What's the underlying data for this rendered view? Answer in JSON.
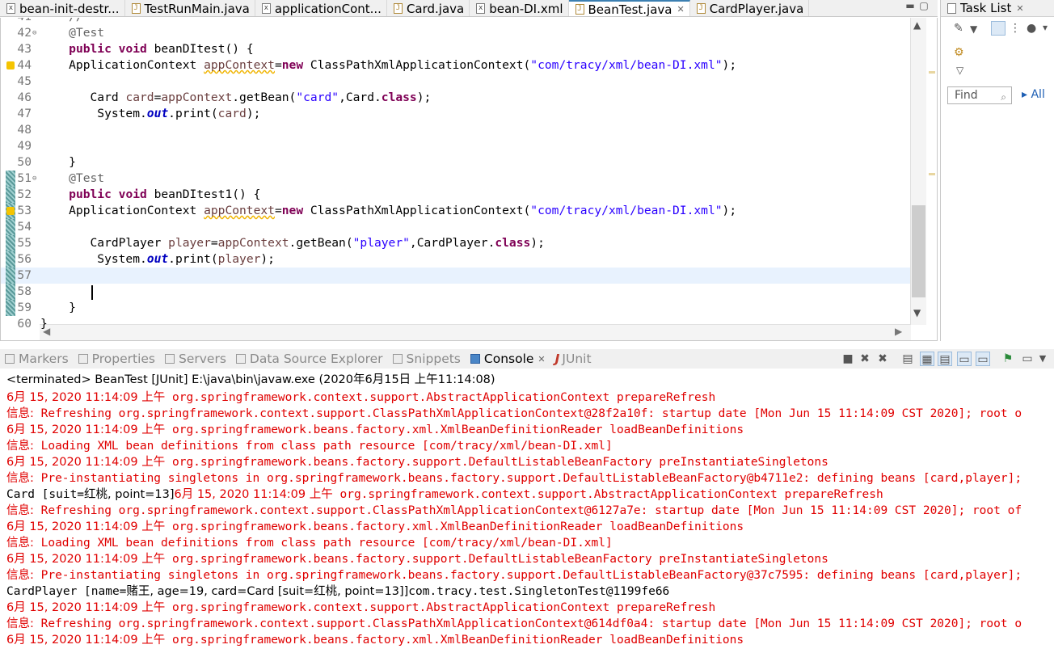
{
  "editor_tabs": [
    {
      "label": "bean-init-destr...",
      "icon": "xml-file-icon",
      "active": false,
      "closable": false
    },
    {
      "label": "TestRunMain.java",
      "icon": "java-file-icon",
      "active": false,
      "closable": false
    },
    {
      "label": "applicationCont...",
      "icon": "xml-file-icon",
      "active": false,
      "closable": false
    },
    {
      "label": "Card.java",
      "icon": "java-file-icon",
      "active": false,
      "closable": false
    },
    {
      "label": "bean-DI.xml",
      "icon": "xml-file-icon",
      "active": false,
      "closable": false
    },
    {
      "label": "BeanTest.java",
      "icon": "java-file-icon",
      "active": true,
      "closable": true
    },
    {
      "label": "CardPlayer.java",
      "icon": "java-file-icon",
      "active": false,
      "closable": false
    }
  ],
  "editor": {
    "lines": [
      {
        "n": "41",
        "segs": [
          {
            "t": "    //",
            "c": "ann"
          }
        ]
      },
      {
        "n": "42",
        "fold": true,
        "segs": [
          {
            "t": "    @Test",
            "c": "ann"
          }
        ]
      },
      {
        "n": "43",
        "segs": [
          {
            "t": "    ",
            "c": ""
          },
          {
            "t": "public",
            "c": "kw"
          },
          {
            "t": " ",
            "c": ""
          },
          {
            "t": "void",
            "c": "kw"
          },
          {
            "t": " beanDItest() {",
            "c": ""
          }
        ]
      },
      {
        "n": "44",
        "warn": true,
        "segs": [
          {
            "t": "    ApplicationContext ",
            "c": ""
          },
          {
            "t": "appContext",
            "c": "var warn"
          },
          {
            "t": "=",
            "c": ""
          },
          {
            "t": "new",
            "c": "kw"
          },
          {
            "t": " ClassPathXmlApplicationContext(",
            "c": ""
          },
          {
            "t": "\"com/tracy/xml/bean-DI.xml\"",
            "c": "str"
          },
          {
            "t": ");",
            "c": ""
          }
        ]
      },
      {
        "n": "45",
        "segs": []
      },
      {
        "n": "46",
        "segs": [
          {
            "t": "       Card ",
            "c": ""
          },
          {
            "t": "card",
            "c": "var"
          },
          {
            "t": "=",
            "c": ""
          },
          {
            "t": "appContext",
            "c": "var"
          },
          {
            "t": ".getBean(",
            "c": ""
          },
          {
            "t": "\"card\"",
            "c": "str"
          },
          {
            "t": ",Card.",
            "c": ""
          },
          {
            "t": "class",
            "c": "kw"
          },
          {
            "t": ");",
            "c": ""
          }
        ]
      },
      {
        "n": "47",
        "segs": [
          {
            "t": "        System.",
            "c": ""
          },
          {
            "t": "out",
            "c": "fld"
          },
          {
            "t": ".print(",
            "c": ""
          },
          {
            "t": "card",
            "c": "var"
          },
          {
            "t": ");",
            "c": ""
          }
        ]
      },
      {
        "n": "48",
        "segs": []
      },
      {
        "n": "49",
        "segs": []
      },
      {
        "n": "50",
        "segs": [
          {
            "t": "    }",
            "c": ""
          }
        ]
      },
      {
        "n": "51",
        "fold": true,
        "mark": true,
        "segs": [
          {
            "t": "    @Test",
            "c": "ann"
          }
        ]
      },
      {
        "n": "52",
        "mark": true,
        "segs": [
          {
            "t": "    ",
            "c": ""
          },
          {
            "t": "public",
            "c": "kw"
          },
          {
            "t": " ",
            "c": ""
          },
          {
            "t": "void",
            "c": "kw"
          },
          {
            "t": " beanDItest1() {",
            "c": ""
          }
        ]
      },
      {
        "n": "53",
        "mark": true,
        "warn": true,
        "segs": [
          {
            "t": "    ApplicationContext ",
            "c": ""
          },
          {
            "t": "appContext",
            "c": "var warn"
          },
          {
            "t": "=",
            "c": ""
          },
          {
            "t": "new",
            "c": "kw"
          },
          {
            "t": " ClassPathXmlApplicationContext(",
            "c": ""
          },
          {
            "t": "\"com/tracy/xml/bean-DI.xml\"",
            "c": "str"
          },
          {
            "t": ");",
            "c": ""
          }
        ]
      },
      {
        "n": "54",
        "mark": true,
        "segs": []
      },
      {
        "n": "55",
        "mark": true,
        "segs": [
          {
            "t": "       CardPlayer ",
            "c": ""
          },
          {
            "t": "player",
            "c": "var"
          },
          {
            "t": "=",
            "c": ""
          },
          {
            "t": "appContext",
            "c": "var"
          },
          {
            "t": ".getBean(",
            "c": ""
          },
          {
            "t": "\"player\"",
            "c": "str"
          },
          {
            "t": ",CardPlayer.",
            "c": ""
          },
          {
            "t": "class",
            "c": "kw"
          },
          {
            "t": ");",
            "c": ""
          }
        ]
      },
      {
        "n": "56",
        "mark": true,
        "segs": [
          {
            "t": "        System.",
            "c": ""
          },
          {
            "t": "out",
            "c": "fld"
          },
          {
            "t": ".print(",
            "c": ""
          },
          {
            "t": "player",
            "c": "var"
          },
          {
            "t": ");",
            "c": ""
          }
        ]
      },
      {
        "n": "57",
        "mark": true,
        "current": true,
        "segs": []
      },
      {
        "n": "58",
        "mark": true,
        "segs": []
      },
      {
        "n": "59",
        "mark": true,
        "segs": [
          {
            "t": "    }",
            "c": ""
          }
        ]
      },
      {
        "n": "60",
        "segs": [
          {
            "t": "}",
            "c": ""
          }
        ]
      }
    ]
  },
  "task_list": {
    "title": "Task List",
    "find_placeholder": "Find",
    "all_label": "All"
  },
  "views": {
    "tabs": [
      {
        "label": "Markers",
        "active": false
      },
      {
        "label": "Properties",
        "active": false
      },
      {
        "label": "Servers",
        "active": false
      },
      {
        "label": "Data Source Explorer",
        "active": false
      },
      {
        "label": "Snippets",
        "active": false
      },
      {
        "label": "Console",
        "active": true
      },
      {
        "label": "JUnit",
        "active": false
      }
    ]
  },
  "console": {
    "status": "<terminated> BeanTest [JUnit] E:\\java\\bin\\javaw.exe (2020年6月15日 上午11:14:08)",
    "lines": [
      {
        "red": true,
        "segs": [
          {
            "t": "6月 15, 2020 11:14:09 上午",
            "cjk": true
          },
          {
            "t": " org.springframework.context.support.AbstractApplicationContext prepareRefresh"
          }
        ]
      },
      {
        "red": true,
        "segs": [
          {
            "t": "信息:",
            "cjk": true
          },
          {
            "t": " Refreshing org.springframework.context.support.ClassPathXmlApplicationContext@28f2a10f: startup date [Mon Jun 15 11:14:09 CST 2020]; root o"
          }
        ]
      },
      {
        "red": true,
        "segs": [
          {
            "t": "6月 15, 2020 11:14:09 上午",
            "cjk": true
          },
          {
            "t": " org.springframework.beans.factory.xml.XmlBeanDefinitionReader loadBeanDefinitions"
          }
        ]
      },
      {
        "red": true,
        "segs": [
          {
            "t": "信息:",
            "cjk": true
          },
          {
            "t": " Loading XML bean definitions from class path resource [com/tracy/xml/bean-DI.xml]"
          }
        ]
      },
      {
        "red": true,
        "segs": [
          {
            "t": "6月 15, 2020 11:14:09 上午",
            "cjk": true
          },
          {
            "t": " org.springframework.beans.factory.support.DefaultListableBeanFactory preInstantiateSingletons"
          }
        ]
      },
      {
        "red": true,
        "segs": [
          {
            "t": "信息:",
            "cjk": true
          },
          {
            "t": " Pre-instantiating singletons in org.springframework.beans.factory.support.DefaultListableBeanFactory@b4711e2: defining beans [card,player];"
          }
        ]
      },
      {
        "red": false,
        "segs": [
          {
            "t": "Card [suit=",
            "blk": true
          },
          {
            "t": "红桃, point=13]",
            "cjk": true,
            "blk": true
          },
          {
            "t": "6月 15, 2020 11:14:09 上午",
            "cjk": true
          },
          {
            "t": " org.springframework.context.support.AbstractApplicationContext prepareRefresh"
          }
        ]
      },
      {
        "red": true,
        "segs": [
          {
            "t": "信息:",
            "cjk": true
          },
          {
            "t": " Refreshing org.springframework.context.support.ClassPathXmlApplicationContext@6127a7e: startup date [Mon Jun 15 11:14:09 CST 2020]; root of"
          }
        ]
      },
      {
        "red": true,
        "segs": [
          {
            "t": "6月 15, 2020 11:14:09 上午",
            "cjk": true
          },
          {
            "t": " org.springframework.beans.factory.xml.XmlBeanDefinitionReader loadBeanDefinitions"
          }
        ]
      },
      {
        "red": true,
        "segs": [
          {
            "t": "信息:",
            "cjk": true
          },
          {
            "t": " Loading XML bean definitions from class path resource [com/tracy/xml/bean-DI.xml]"
          }
        ]
      },
      {
        "red": true,
        "segs": [
          {
            "t": "6月 15, 2020 11:14:09 上午",
            "cjk": true
          },
          {
            "t": " org.springframework.beans.factory.support.DefaultListableBeanFactory preInstantiateSingletons"
          }
        ]
      },
      {
        "red": true,
        "segs": [
          {
            "t": "信息:",
            "cjk": true
          },
          {
            "t": " Pre-instantiating singletons in org.springframework.beans.factory.support.DefaultListableBeanFactory@37c7595: defining beans [card,player];"
          }
        ]
      },
      {
        "red": false,
        "segs": [
          {
            "t": "CardPlayer [name=",
            "blk": true
          },
          {
            "t": "赌王, age=19, card=Card [suit=红桃, point=13]]",
            "cjk": true,
            "blk": true
          },
          {
            "t": "com.tracy.test.SingletonTest@1199fe66",
            "blk": true
          }
        ]
      },
      {
        "red": true,
        "segs": [
          {
            "t": "6月 15, 2020 11:14:09 上午",
            "cjk": true
          },
          {
            "t": " org.springframework.context.support.AbstractApplicationContext prepareRefresh"
          }
        ]
      },
      {
        "red": true,
        "segs": [
          {
            "t": "信息:",
            "cjk": true
          },
          {
            "t": " Refreshing org.springframework.context.support.ClassPathXmlApplicationContext@614df0a4: startup date [Mon Jun 15 11:14:09 CST 2020]; root o"
          }
        ]
      },
      {
        "red": true,
        "segs": [
          {
            "t": "6月 15, 2020 11:14:09 上午",
            "cjk": true
          },
          {
            "t": " org.springframework.beans.factory.xml.XmlBeanDefinitionReader loadBeanDefinitions"
          }
        ]
      }
    ]
  }
}
